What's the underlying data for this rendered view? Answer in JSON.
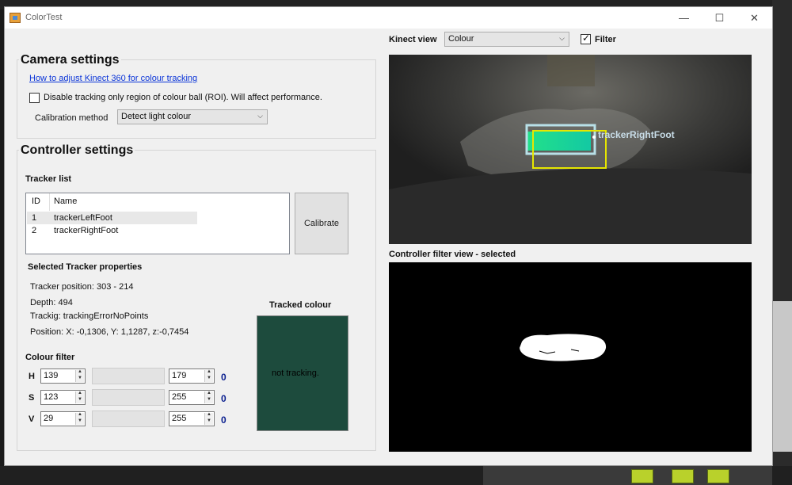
{
  "window": {
    "title": "ColorTest"
  },
  "title_buttons": {
    "minimize": "—",
    "maximize": "☐",
    "close": "✕"
  },
  "camera_settings": {
    "title": "Camera settings",
    "help_link": "How to adjust Kinect 360 for colour tracking",
    "disable_roi_label": "Disable tracking only region of colour ball (ROI). Will affect performance.",
    "disable_roi_checked": false,
    "calibration_label": "Calibration method",
    "calibration_value": "Detect light colour"
  },
  "controller_settings": {
    "title": "Controller settings",
    "tracker_list_label": "Tracker list",
    "columns": [
      "ID",
      "Name"
    ],
    "trackers": [
      {
        "id": "1",
        "name": "trackerLeftFoot",
        "selected": true
      },
      {
        "id": "2",
        "name": "trackerRightFoot",
        "selected": false
      }
    ],
    "calibrate_button": "Calibrate",
    "selected_props_title": "Selected Tracker properties",
    "position": "Tracker position: 303 - 214",
    "depth": "Depth: 494",
    "tracking": "Trackig: trackingErrorNoPoints",
    "position3d": "Position: X: -0,1306, Y: 1,1287, z:-0,7454",
    "tracked_colour_label": "Tracked colour",
    "tracked_colour_text": "not tracking.",
    "tracked_colour_hex": "#1d4b3d",
    "colour_filter_label": "Colour filter",
    "filters": [
      {
        "label": "H",
        "min": "139",
        "max": "179",
        "out": "0"
      },
      {
        "label": "S",
        "min": "123",
        "max": "255",
        "out": "0"
      },
      {
        "label": "V",
        "min": "29",
        "max": "255",
        "out": "0"
      }
    ]
  },
  "kinect": {
    "view_label": "Kinect view",
    "view_value": "Colour",
    "filter_label": "Filter",
    "filter_checked": true,
    "tracker_label": "trackerRightFoot",
    "filter_view_label": "Controller filter view - selected"
  },
  "colors": {
    "link": "#0b35d8",
    "tracked_box": "#e6e600",
    "roi_box": "#b8e0e8",
    "blob": "#1ed68f",
    "hsv_out": "#0a1f8f"
  }
}
